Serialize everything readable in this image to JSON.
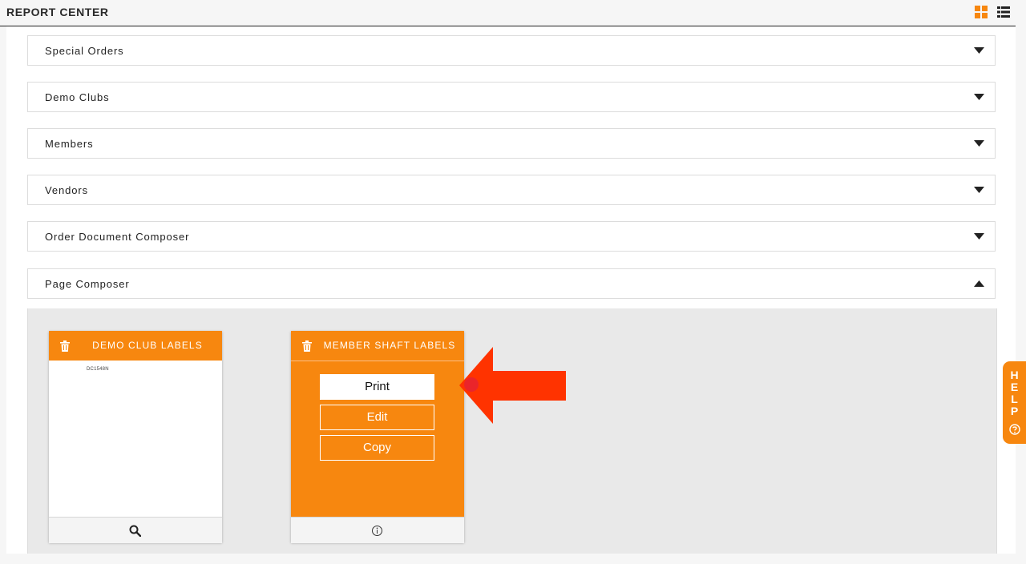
{
  "header": {
    "title": "REPORT CENTER",
    "grid_view_icon": "grid-view-icon",
    "list_view_icon": "list-view-icon"
  },
  "accordions": [
    {
      "label": "Special Orders",
      "state": "collapsed"
    },
    {
      "label": "Demo Clubs",
      "state": "collapsed"
    },
    {
      "label": "Members",
      "state": "collapsed"
    },
    {
      "label": "Vendors",
      "state": "collapsed"
    },
    {
      "label": "Order Document Composer",
      "state": "collapsed"
    },
    {
      "label": "Page Composer",
      "state": "expanded"
    }
  ],
  "page_composer": {
    "cards": [
      {
        "title": "DEMO CLUB LABELS",
        "preview_text": "DC1548N",
        "footer_icon": "search-icon"
      },
      {
        "title": "MEMBER SHAFT LABELS",
        "actions": [
          "Print",
          "Edit",
          "Copy"
        ],
        "footer_icon": "info-icon"
      }
    ]
  },
  "help_tab": {
    "letters": [
      "H",
      "E",
      "L",
      "P"
    ],
    "icon": "question-icon"
  },
  "colors": {
    "accent": "#f7870f",
    "annotation_arrow": "#ff3300",
    "panel_background": "#e9e9e9"
  }
}
